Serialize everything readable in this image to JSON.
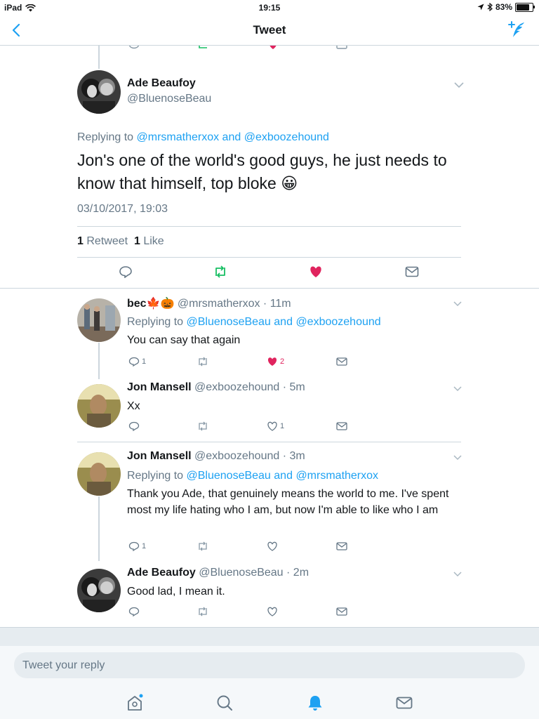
{
  "status_bar": {
    "device": "iPad",
    "time": "19:15",
    "battery": "83%"
  },
  "nav": {
    "title": "Tweet"
  },
  "main_tweet": {
    "name": "Ade Beaufoy",
    "handle": "@BluenoseBeau",
    "replying_prefix": "Replying to",
    "replying_user1": "@mrsmatherxox",
    "replying_and": "and",
    "replying_user2": "@exboozehound",
    "text": "Jon's one of the world's good guys, he just needs to know that himself, top bloke",
    "emoji": "😀",
    "timestamp": "03/10/2017, 19:03",
    "retweets_count": "1",
    "retweets_label": "Retweet",
    "likes_count": "1",
    "likes_label": "Like"
  },
  "replies": [
    {
      "name": "bec🍁🎃",
      "handle": "@mrsmatherxox",
      "time": "11m",
      "replying_prefix": "Replying to",
      "replying_user1": "@BluenoseBeau",
      "replying_and": "and",
      "replying_user2": "@exboozehound",
      "text": "You can say that again",
      "reply_count": "1",
      "retweet_count": "",
      "like_count": "2",
      "liked": true
    },
    {
      "name": "Jon Mansell",
      "handle": "@exboozehound",
      "time": "5m",
      "text": "Xx",
      "reply_count": "",
      "retweet_count": "",
      "like_count": "1",
      "liked": false
    },
    {
      "name": "Jon Mansell",
      "handle": "@exboozehound",
      "time": "3m",
      "replying_prefix": "Replying to",
      "replying_user1": "@BluenoseBeau",
      "replying_and": "and",
      "replying_user2": "@mrsmatherxox",
      "text": "Thank you Ade, that genuinely means the world to me. I've spent most my life hating who I am, but now I'm able to like who I am",
      "reply_count": "1",
      "retweet_count": "",
      "like_count": "",
      "liked": false
    },
    {
      "name": "Ade Beaufoy",
      "handle": "@BluenoseBeau",
      "time": "2m",
      "text": "Good lad, I mean it.",
      "reply_count": "",
      "retweet_count": "",
      "like_count": "",
      "liked": false
    }
  ],
  "reply_box": {
    "placeholder": "Tweet your reply"
  },
  "tabbar": [
    "home-icon",
    "search-icon",
    "notifications-icon",
    "messages-icon"
  ],
  "colors": {
    "accent": "#1da1f2",
    "like": "#e0245e",
    "retweet": "#17bf63",
    "muted": "#657786",
    "divider": "#ccd6dd"
  }
}
